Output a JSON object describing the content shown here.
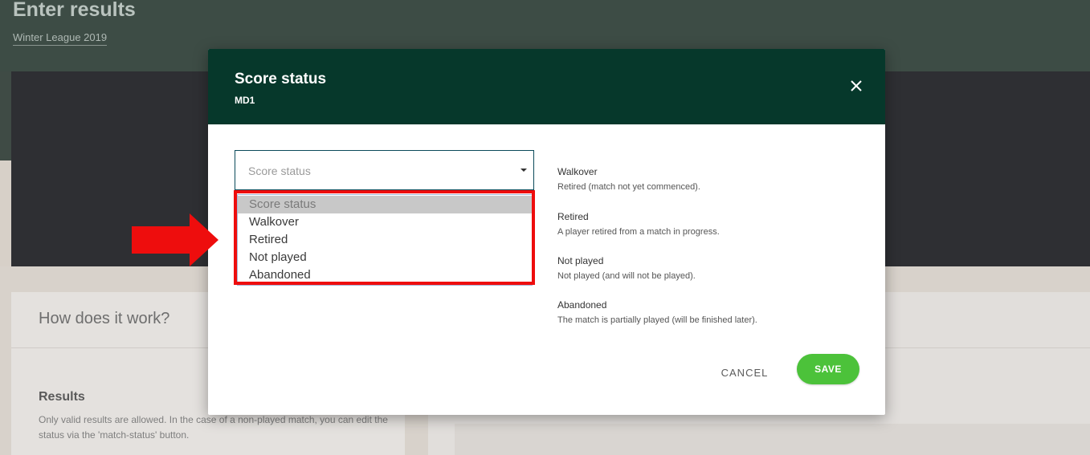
{
  "page": {
    "title": "Enter results",
    "subtitle": "Winter League 2019",
    "how_title": "How does it work?",
    "results_heading": "Results",
    "results_text": "Only valid results are allowed. In the case of a non-played match, you can edit the status via the 'match-status' button."
  },
  "modal": {
    "title": "Score status",
    "subtitle": "MD1",
    "select": {
      "value": "Score status",
      "options": [
        {
          "label": "Score status",
          "selected": true
        },
        {
          "label": "Walkover",
          "selected": false
        },
        {
          "label": "Retired",
          "selected": false
        },
        {
          "label": "Not played",
          "selected": false
        },
        {
          "label": "Abandoned",
          "selected": false
        }
      ]
    },
    "descriptions": [
      {
        "title": "Walkover",
        "text": "Retired (match not yet commenced)."
      },
      {
        "title": "Retired",
        "text": "A player retired from a match in progress."
      },
      {
        "title": "Not played",
        "text": "Not played (and will not be played)."
      },
      {
        "title": "Abandoned",
        "text": "The match is partially played (will be finished later)."
      }
    ],
    "cancel_label": "CANCEL",
    "save_label": "SAVE"
  },
  "colors": {
    "modal_header": "#06382b",
    "save_button": "#4cc23a",
    "annotation_red": "#ee0d0d"
  },
  "icons": {
    "close": "close-icon",
    "caret": "chevron-down-icon",
    "annotation": "red-arrow-icon"
  }
}
